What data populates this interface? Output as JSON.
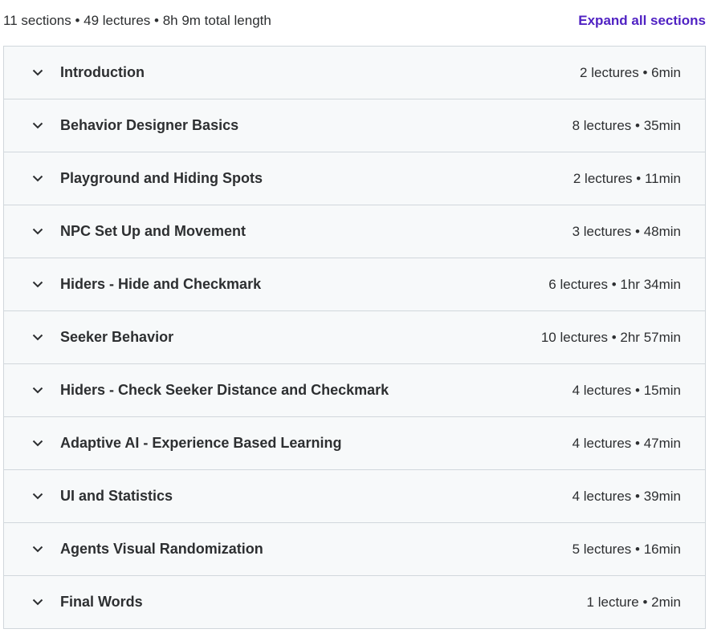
{
  "summary": "11 sections • 49 lectures • 8h 9m total length",
  "expand_all_label": "Expand all sections",
  "icon": "chevron-down-icon",
  "colors": {
    "accent": "#5022c3",
    "section_bg": "#f7f9fa",
    "border": "#d1d7dc",
    "text": "#2d2f31"
  },
  "sections": [
    {
      "title": "Introduction",
      "meta": "2 lectures • 6min"
    },
    {
      "title": "Behavior Designer Basics",
      "meta": "8 lectures • 35min"
    },
    {
      "title": "Playground and Hiding Spots",
      "meta": "2 lectures • 11min"
    },
    {
      "title": "NPC Set Up and Movement",
      "meta": "3 lectures • 48min"
    },
    {
      "title": "Hiders - Hide and Checkmark",
      "meta": "6 lectures • 1hr 34min"
    },
    {
      "title": "Seeker Behavior",
      "meta": "10 lectures • 2hr 57min"
    },
    {
      "title": "Hiders - Check Seeker Distance and Checkmark",
      "meta": "4 lectures • 15min"
    },
    {
      "title": "Adaptive AI - Experience Based Learning",
      "meta": "4 lectures • 47min"
    },
    {
      "title": "UI and Statistics",
      "meta": "4 lectures • 39min"
    },
    {
      "title": "Agents Visual Randomization",
      "meta": "5 lectures • 16min"
    },
    {
      "title": "Final Words",
      "meta": "1 lecture • 2min"
    }
  ]
}
